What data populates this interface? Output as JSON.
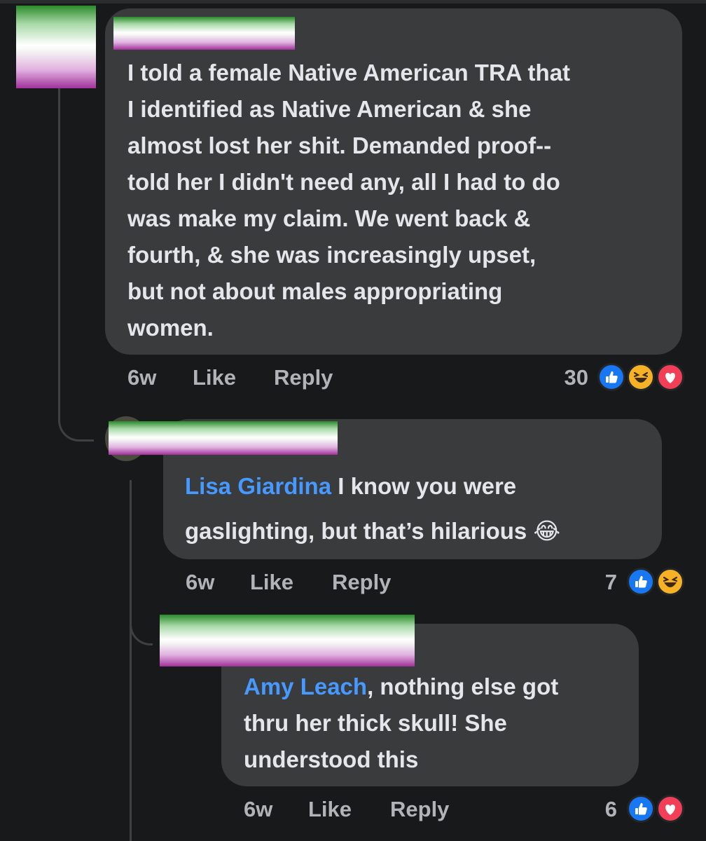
{
  "comments": [
    {
      "text": "I told a female Native American TRA that I identified as Native American & she almost lost her shit. Demanded proof-- told her I didn't need any, all I had to do was make my claim. We went back & fourth, & she was increasingly upset, but not about males appropriating women.",
      "lines": [
        "I told a female Native American TRA that",
        "I identified as Native American & she",
        "almost lost her shit. Demanded proof--",
        "told her I didn't need any, all I had to do",
        "was make my claim. We went back &",
        "fourth, & she was increasingly upset,",
        "but not about males appropriating",
        "women."
      ],
      "time": "6w",
      "like_label": "Like",
      "reply_label": "Reply",
      "reaction_count": "30",
      "reactions": [
        "like-icon",
        "haha-icon",
        "love-icon"
      ]
    },
    {
      "mention": "Lisa Giardina",
      "line1_rest": " I know you were",
      "line2": "gaslighting, but that’s hilarious",
      "emoji": "😂",
      "time": "6w",
      "like_label": "Like",
      "reply_label": "Reply",
      "reaction_count": "7",
      "reactions": [
        "like-icon",
        "haha-icon"
      ]
    },
    {
      "mention": "Amy Leach",
      "line1_rest": ", nothing else got",
      "line2": "thru her thick skull! She",
      "line3": "understood this",
      "time": "6w",
      "like_label": "Like",
      "reply_label": "Reply",
      "reaction_count": "6",
      "reactions": [
        "like-icon",
        "love-icon"
      ]
    }
  ],
  "colors": {
    "background": "#18191a",
    "bubble": "#3a3b3c",
    "text": "#e4e6eb",
    "meta": "#b0b3b8",
    "mention": "#4599ff",
    "like": "#1877f2",
    "haha": "#f7b125",
    "love": "#f33e58"
  }
}
